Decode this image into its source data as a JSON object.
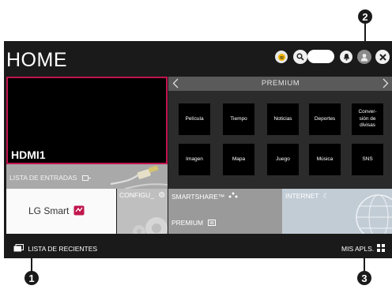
{
  "header": {
    "title": "HOME"
  },
  "live": {
    "input_name": "HDMI1",
    "inputs_list_label": "LISTA DE ENTRADAS"
  },
  "premium": {
    "title": "PREMIUM",
    "tiles": [
      "Película",
      "Tiempo",
      "Noticias",
      "Deportes",
      "Conver-\nsión de\ndivisas",
      "Imagen",
      "Mapa",
      "Juego",
      "Música",
      "SNS"
    ]
  },
  "cards": {
    "lg_brand": "LG Smart",
    "settings_label": "CONFIGU_",
    "smartshare_label": "SMARTSHARE™",
    "smartshare_sub": "PREMIUM",
    "internet_label": "INTERNET"
  },
  "footer": {
    "recent_label": "LISTA DE RECIENTES",
    "my_apps_label": "MIS APLS."
  },
  "callouts": [
    "1",
    "2",
    "3"
  ]
}
